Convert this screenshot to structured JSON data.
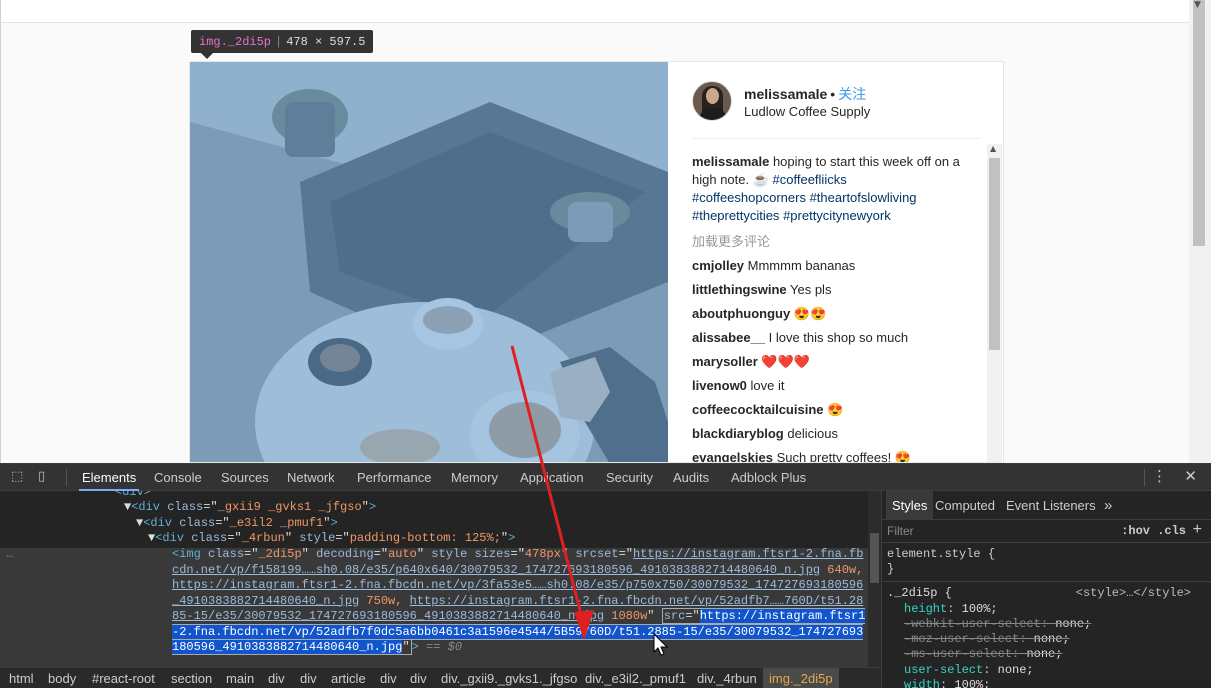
{
  "tooltip": {
    "tag": "img._2di5p",
    "dims": "478 × 597.5"
  },
  "post": {
    "username": "melissamale",
    "dot": "•",
    "follow": "关注",
    "location": "Ludlow Coffee Supply",
    "caption_user": "melissamale",
    "caption_text": " hoping to start this week off on a high note. ☕ ",
    "caption_tags": [
      "#coffeefliicks",
      "#coffeeshopcorners",
      "#theartofslowliving",
      "#theprettycities",
      "#prettycitynewyork"
    ],
    "load_more": "加载更多评论",
    "comments": [
      {
        "user": "cmjolley",
        "text": " Mmmmm bananas"
      },
      {
        "user": "littlethingswine",
        "text": " Yes pls"
      },
      {
        "user": "aboutphuonguy",
        "text": " 😍😍"
      },
      {
        "user": "alissabee__",
        "text": " I love this shop so much"
      },
      {
        "user": "marysoller",
        "text": " ❤️❤️❤️"
      },
      {
        "user": "livenow0",
        "text": " love it"
      },
      {
        "user": "coffeecocktailcuisine",
        "text": " 😍"
      },
      {
        "user": "blackdiaryblog",
        "text": " delicious"
      },
      {
        "user": "evangelskies",
        "text": " Such pretty coffees! 😍"
      }
    ]
  },
  "devtools": {
    "tabs": [
      "Elements",
      "Console",
      "Sources",
      "Network",
      "Performance",
      "Memory",
      "Application",
      "Security",
      "Audits",
      "Adblock Plus"
    ],
    "active_tab": "Elements",
    "elements": {
      "line0": "<div>",
      "line1_tag": "div",
      "line1_class": "_gxii9 _gvks1  _jfgso",
      "line2_tag": "div",
      "line2_class": "_e3il2 _pmuf1",
      "line3_tag": "div",
      "line3_class": "_4rbun",
      "line3_style": "padding-bottom: 125%;",
      "img_class": "_2di5p",
      "img_decoding": "auto",
      "img_sizes": "478px",
      "srcset_1": "https://instagram.ftsr1-2.fna.fbcdn.net/vp/f158199……sh0.08/e35/p640x640/30079532_174727693180596_4910383882714480640_n.jpg",
      "srcset_1_w": " 640w, ",
      "srcset_2": "https://instagram.ftsr1-2.fna.fbcdn.net/vp/3fa53e5……sh0.08/e35/p750x750/30079532_174727693180596_4910383882714480640_n.jpg",
      "srcset_2_w": " 750w, ",
      "srcset_3": "https://instagram.ftsr1-2.fna.fbcdn.net/vp/52adfb7……760D/t51.2885-15/e35/30079532_174727693180596_4910383882714480640_n.jpg",
      "srcset_3_w": " 1080w",
      "src": "https://instagram.ftsr1-2.fna.fbcdn.net/vp/52adfb7f0dc5a6bb0461c3a1596e4544/5B59760D/t51.2885-15/e35/30079532_174727693180596_4910383882714480640_n.jpg",
      "eq0": " == $0"
    },
    "styles_tabs": [
      "Styles",
      "Computed",
      "Event Listeners"
    ],
    "filter_placeholder": "Filter",
    "hov": ":hov",
    "cls": ".cls",
    "element_style": "element.style {",
    "close_brace": "}",
    "rule_selector": "._2di5p {",
    "rule_origin": "<style>…</style>",
    "props": [
      {
        "name": "height",
        "value": "100%;",
        "struck": false
      },
      {
        "name": "-webkit-user-select",
        "value": "none;",
        "struck": true
      },
      {
        "name": "-moz-user-select",
        "value": "none;",
        "struck": true
      },
      {
        "name": "-ms-user-select",
        "value": "none;",
        "struck": true
      },
      {
        "name": "user-select",
        "value": "none;",
        "struck": false
      },
      {
        "name": "width",
        "value": "100%;",
        "struck": false
      }
    ],
    "breadcrumbs": [
      "html",
      "body",
      "#react-root",
      "section",
      "main",
      "div",
      "div",
      "article",
      "div",
      "div",
      "div._gxii9._gvks1._jfgso",
      "div._e3il2._pmuf1",
      "div._4rbun",
      "img._2di5p"
    ]
  }
}
